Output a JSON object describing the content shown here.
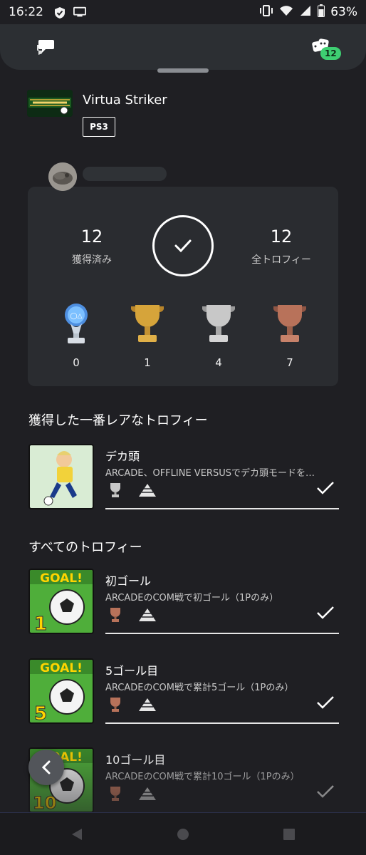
{
  "status_bar": {
    "time": "16:22",
    "battery": "63%"
  },
  "header": {
    "badge_count": "12"
  },
  "game": {
    "title": "Virtua Striker",
    "platform": "PS3"
  },
  "summary": {
    "earned_value": "12",
    "earned_label": "獲得済み",
    "total_value": "12",
    "total_label": "全トロフィー",
    "trophies": [
      {
        "type": "platinum",
        "count": "0"
      },
      {
        "type": "gold",
        "count": "1"
      },
      {
        "type": "silver",
        "count": "4"
      },
      {
        "type": "bronze",
        "count": "7"
      }
    ]
  },
  "rarest_section": {
    "title": "獲得した一番レアなトロフィー",
    "trophy": {
      "name": "デカ頭",
      "description": "ARCADE、OFFLINE VERSUSでデカ頭モードを…",
      "grade": "silver"
    }
  },
  "all_section": {
    "title": "すべてのトロフィー",
    "trophies": [
      {
        "name": "初ゴール",
        "description": "ARCADEのCOM戦で初ゴール（1Pのみ）",
        "grade": "bronze",
        "image_number": "1",
        "image_text": "GOAL!"
      },
      {
        "name": "5ゴール目",
        "description": "ARCADEのCOM戦で累計5ゴール（1Pのみ）",
        "grade": "bronze",
        "image_number": "5",
        "image_text": "GOAL!"
      },
      {
        "name": "10ゴール目",
        "description": "ARCADEのCOM戦で累計10ゴール（1Pのみ）",
        "grade": "bronze",
        "image_number": "10",
        "image_text": "GOAL!"
      }
    ]
  },
  "colors": {
    "background": "#1f1f23",
    "card": "#2a2c30",
    "badge": "#3ecf72",
    "platinum": "#6fb6ff",
    "gold": "#d6a43a",
    "silver": "#c8c8c8",
    "bronze": "#b8725a"
  }
}
